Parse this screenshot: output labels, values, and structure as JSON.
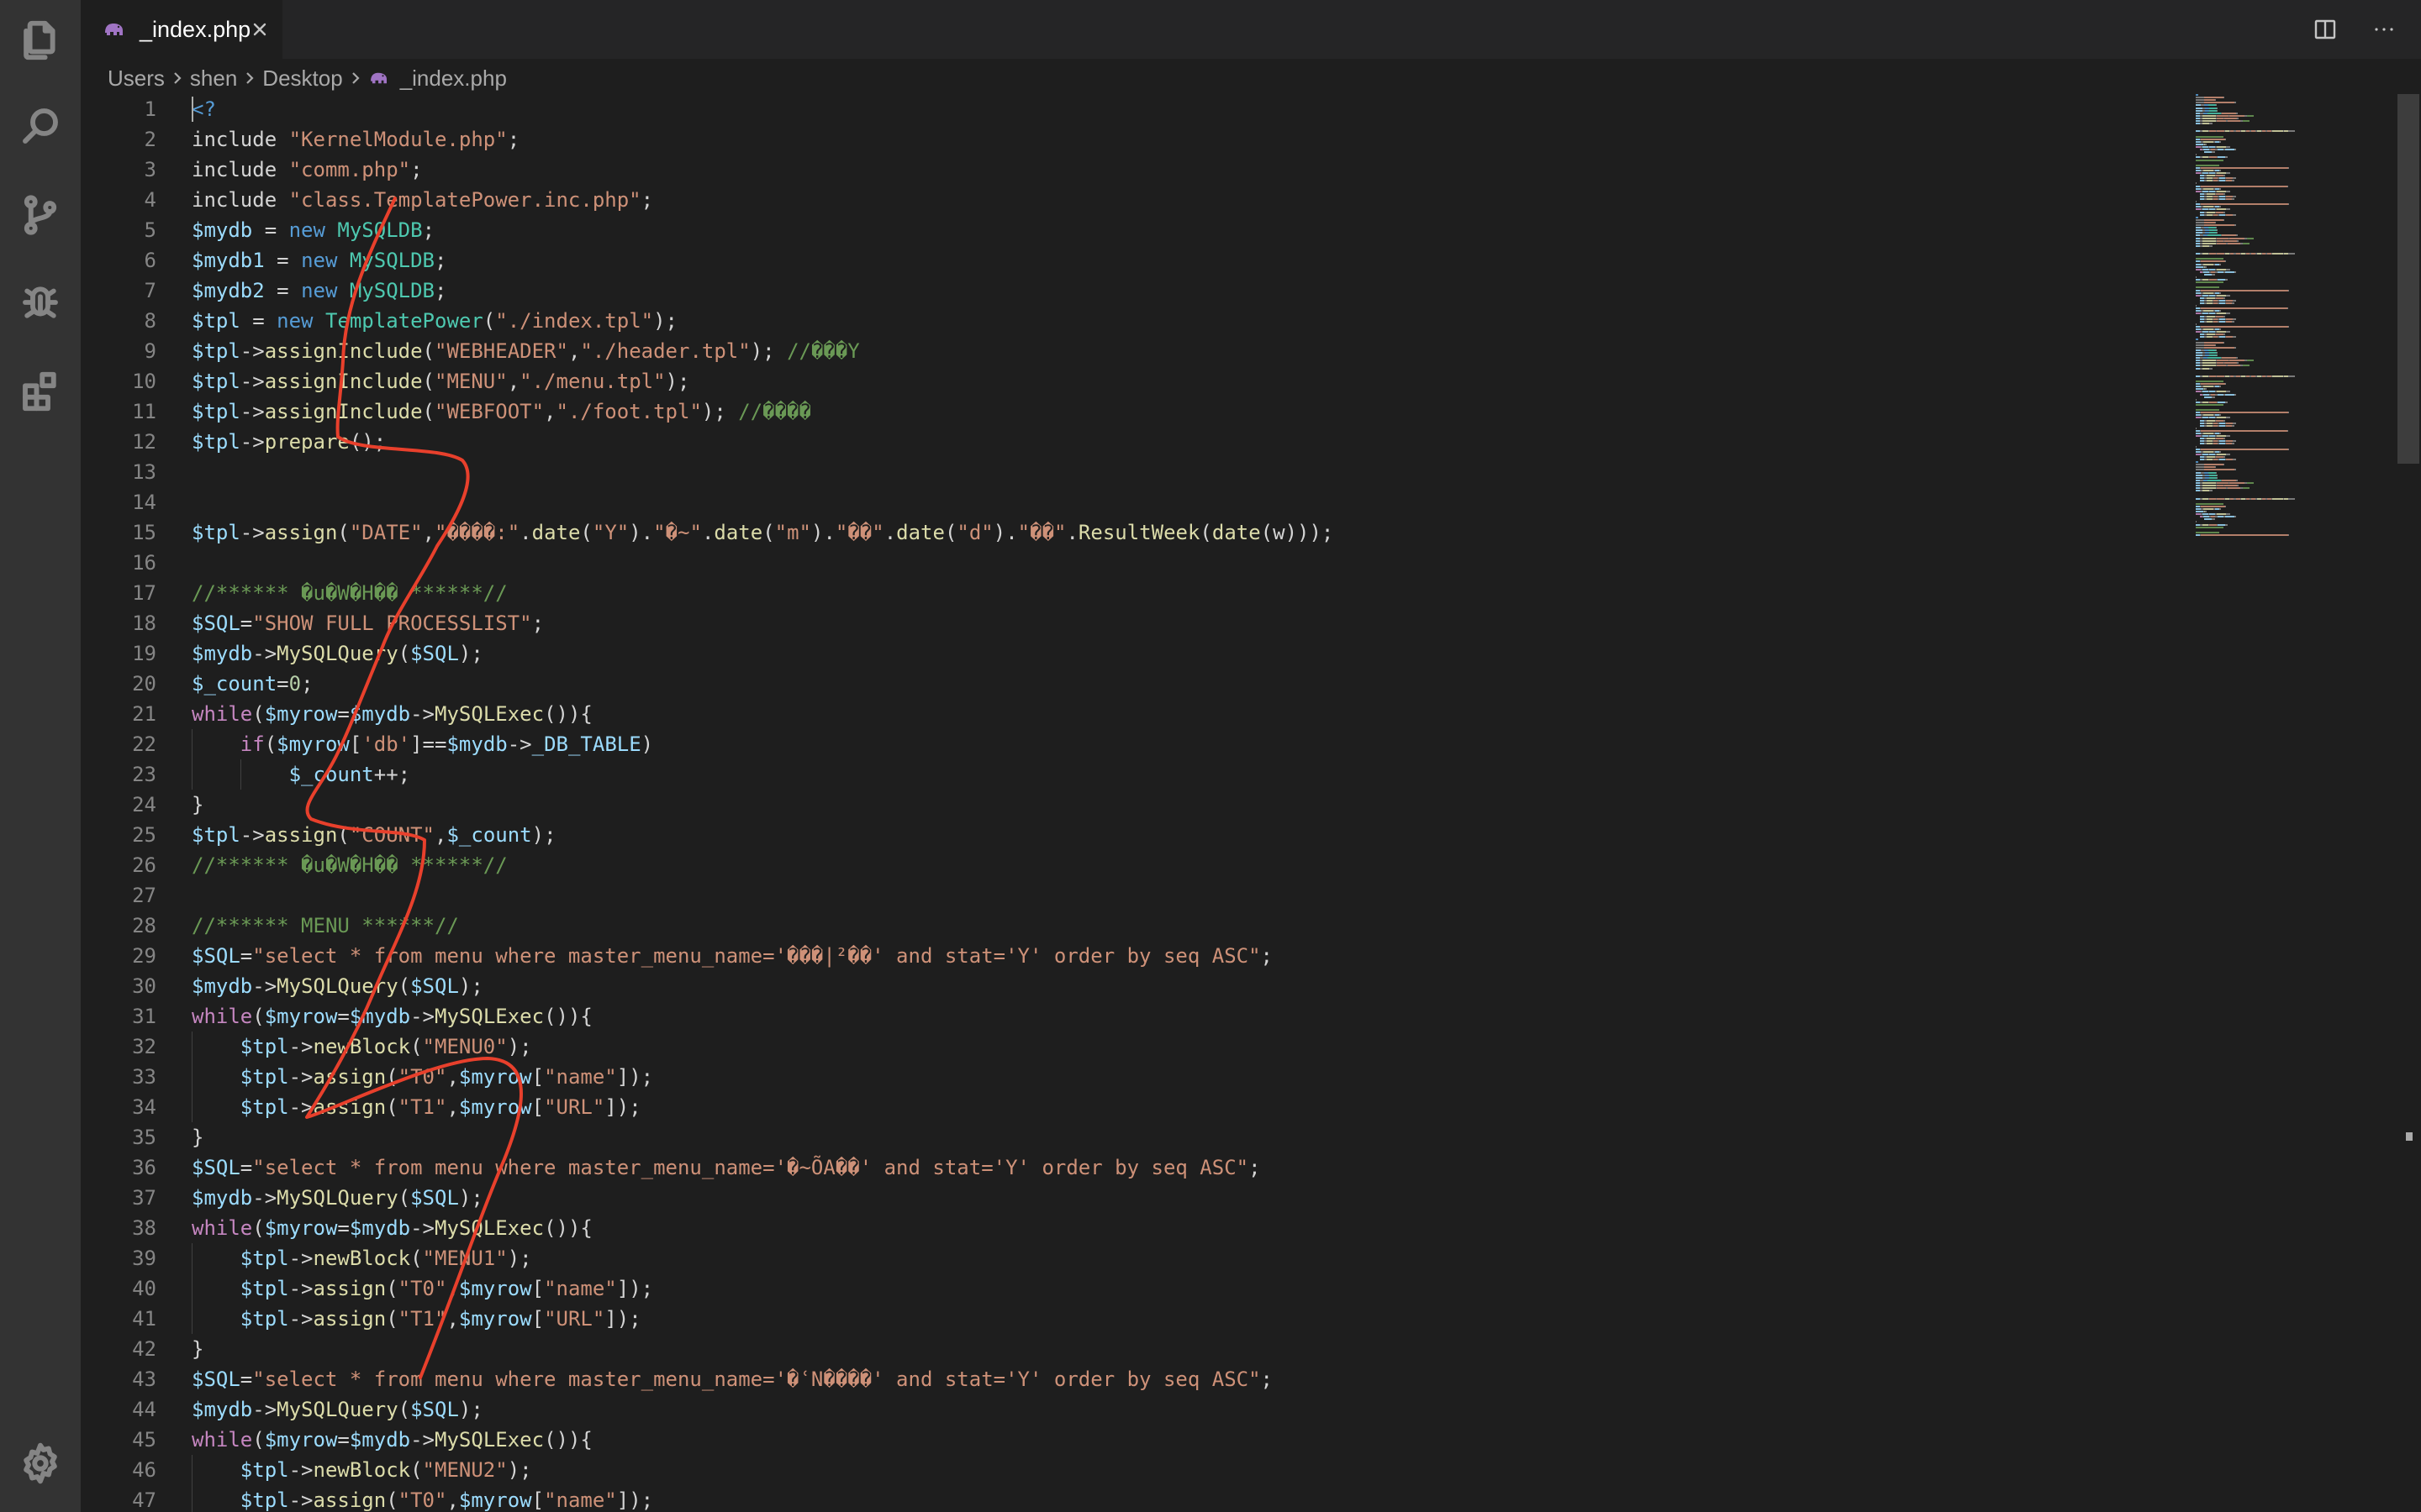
{
  "activity_bar": {
    "items": [
      {
        "name": "explorer-icon",
        "active": false
      },
      {
        "name": "search-icon",
        "active": false
      },
      {
        "name": "source-control-icon",
        "active": false
      },
      {
        "name": "debug-icon",
        "active": false
      },
      {
        "name": "extensions-icon",
        "active": false
      }
    ],
    "bottom": {
      "name": "gear-icon"
    }
  },
  "tab": {
    "label": "_index.php",
    "icon": "php-elephant-icon",
    "accent": "#a074c4"
  },
  "tab_actions": [
    {
      "name": "split-editor-icon"
    },
    {
      "name": "more-actions-icon"
    }
  ],
  "breadcrumb": [
    "Users",
    "shen",
    "Desktop",
    "_index.php"
  ],
  "editor": {
    "first_line_number": 1,
    "lines": [
      [
        [
          "t-tag",
          "<?"
        ]
      ],
      [
        [
          "t-txt",
          "include "
        ],
        [
          "t-str",
          "\"KernelModule.php\""
        ],
        [
          "t-txt",
          ";"
        ]
      ],
      [
        [
          "t-txt",
          "include "
        ],
        [
          "t-str",
          "\"comm.php\""
        ],
        [
          "t-txt",
          ";"
        ]
      ],
      [
        [
          "t-txt",
          "include "
        ],
        [
          "t-str",
          "\"class.TemplatePower.inc.php\""
        ],
        [
          "t-txt",
          ";"
        ]
      ],
      [
        [
          "t-var",
          "$mydb"
        ],
        [
          "t-txt",
          " = "
        ],
        [
          "t-kw2",
          "new "
        ],
        [
          "t-cls",
          "MySQLDB"
        ],
        [
          "t-txt",
          ";"
        ]
      ],
      [
        [
          "t-var",
          "$mydb1"
        ],
        [
          "t-txt",
          " = "
        ],
        [
          "t-kw2",
          "new "
        ],
        [
          "t-cls",
          "MySQLDB"
        ],
        [
          "t-txt",
          ";"
        ]
      ],
      [
        [
          "t-var",
          "$mydb2"
        ],
        [
          "t-txt",
          " = "
        ],
        [
          "t-kw2",
          "new "
        ],
        [
          "t-cls",
          "MySQLDB"
        ],
        [
          "t-txt",
          ";"
        ]
      ],
      [
        [
          "t-var",
          "$tpl"
        ],
        [
          "t-txt",
          " = "
        ],
        [
          "t-kw2",
          "new "
        ],
        [
          "t-cls",
          "TemplatePower"
        ],
        [
          "t-txt",
          "("
        ],
        [
          "t-str",
          "\"./index.tpl\""
        ],
        [
          "t-txt",
          ");"
        ]
      ],
      [
        [
          "t-var",
          "$tpl"
        ],
        [
          "t-txt",
          "->"
        ],
        [
          "t-fn",
          "assignInclude"
        ],
        [
          "t-txt",
          "("
        ],
        [
          "t-str",
          "\"WEBHEADER\""
        ],
        [
          "t-txt",
          ","
        ],
        [
          "t-str",
          "\"./header.tpl\""
        ],
        [
          "t-txt",
          "); "
        ],
        [
          "t-com",
          "//���Y"
        ]
      ],
      [
        [
          "t-var",
          "$tpl"
        ],
        [
          "t-txt",
          "->"
        ],
        [
          "t-fn",
          "assignInclude"
        ],
        [
          "t-txt",
          "("
        ],
        [
          "t-str",
          "\"MENU\""
        ],
        [
          "t-txt",
          ","
        ],
        [
          "t-str",
          "\"./menu.tpl\""
        ],
        [
          "t-txt",
          ");"
        ]
      ],
      [
        [
          "t-var",
          "$tpl"
        ],
        [
          "t-txt",
          "->"
        ],
        [
          "t-fn",
          "assignInclude"
        ],
        [
          "t-txt",
          "("
        ],
        [
          "t-str",
          "\"WEBFOOT\""
        ],
        [
          "t-txt",
          ","
        ],
        [
          "t-str",
          "\"./foot.tpl\""
        ],
        [
          "t-txt",
          "); "
        ],
        [
          "t-com",
          "//����"
        ]
      ],
      [
        [
          "t-var",
          "$tpl"
        ],
        [
          "t-txt",
          "->"
        ],
        [
          "t-fn",
          "prepare"
        ],
        [
          "t-txt",
          "();"
        ]
      ],
      [],
      [],
      [
        [
          "t-var",
          "$tpl"
        ],
        [
          "t-txt",
          "->"
        ],
        [
          "t-fn",
          "assign"
        ],
        [
          "t-txt",
          "("
        ],
        [
          "t-str",
          "\"DATE\""
        ],
        [
          "t-txt",
          ","
        ],
        [
          "t-str",
          "\"����:\""
        ],
        [
          "t-txt",
          "."
        ],
        [
          "t-fn",
          "date"
        ],
        [
          "t-txt",
          "("
        ],
        [
          "t-str",
          "\"Y\""
        ],
        [
          "t-txt",
          ")."
        ],
        [
          "t-str",
          "\"�~\""
        ],
        [
          "t-txt",
          "."
        ],
        [
          "t-fn",
          "date"
        ],
        [
          "t-txt",
          "("
        ],
        [
          "t-str",
          "\"m\""
        ],
        [
          "t-txt",
          ")."
        ],
        [
          "t-str",
          "\"��\""
        ],
        [
          "t-txt",
          "."
        ],
        [
          "t-fn",
          "date"
        ],
        [
          "t-txt",
          "("
        ],
        [
          "t-str",
          "\"d\""
        ],
        [
          "t-txt",
          ")."
        ],
        [
          "t-str",
          "\"��\""
        ],
        [
          "t-txt",
          "."
        ],
        [
          "t-fn",
          "ResultWeek"
        ],
        [
          "t-txt",
          "("
        ],
        [
          "t-fn",
          "date"
        ],
        [
          "t-txt",
          "(w)));"
        ]
      ],
      [],
      [
        [
          "t-com",
          "//****** �u�W�H�� ******//"
        ]
      ],
      [
        [
          "t-var",
          "$SQL"
        ],
        [
          "t-txt",
          "="
        ],
        [
          "t-str",
          "\"SHOW FULL PROCESSLIST\""
        ],
        [
          "t-txt",
          ";"
        ]
      ],
      [
        [
          "t-var",
          "$mydb"
        ],
        [
          "t-txt",
          "->"
        ],
        [
          "t-fn",
          "MySQLQuery"
        ],
        [
          "t-txt",
          "("
        ],
        [
          "t-var",
          "$SQL"
        ],
        [
          "t-txt",
          ");"
        ]
      ],
      [
        [
          "t-var",
          "$_count"
        ],
        [
          "t-txt",
          "="
        ],
        [
          "t-num",
          "0"
        ],
        [
          "t-txt",
          ";"
        ]
      ],
      [
        [
          "t-kw",
          "while"
        ],
        [
          "t-txt",
          "("
        ],
        [
          "t-var",
          "$myrow"
        ],
        [
          "t-txt",
          "="
        ],
        [
          "t-var",
          "$mydb"
        ],
        [
          "t-txt",
          "->"
        ],
        [
          "t-fn",
          "MySQLExec"
        ],
        [
          "t-txt",
          "()){"
        ]
      ],
      [
        [
          "t-txt",
          "    "
        ],
        [
          "t-kw",
          "if"
        ],
        [
          "t-txt",
          "("
        ],
        [
          "t-var",
          "$myrow"
        ],
        [
          "t-txt",
          "["
        ],
        [
          "t-str",
          "'db'"
        ],
        [
          "t-txt",
          "]=="
        ],
        [
          "t-var",
          "$mydb"
        ],
        [
          "t-txt",
          "->"
        ],
        [
          "t-var",
          "_DB_TABLE"
        ],
        [
          "t-txt",
          ")"
        ]
      ],
      [
        [
          "t-txt",
          "        "
        ],
        [
          "t-var",
          "$_count"
        ],
        [
          "t-txt",
          "++;"
        ]
      ],
      [
        [
          "t-txt",
          "}"
        ]
      ],
      [
        [
          "t-var",
          "$tpl"
        ],
        [
          "t-txt",
          "->"
        ],
        [
          "t-fn",
          "assign"
        ],
        [
          "t-txt",
          "("
        ],
        [
          "t-str",
          "\"COUNT\""
        ],
        [
          "t-txt",
          ","
        ],
        [
          "t-var",
          "$_count"
        ],
        [
          "t-txt",
          ");"
        ]
      ],
      [
        [
          "t-com",
          "//****** �u�W�H�� ******//"
        ]
      ],
      [],
      [
        [
          "t-com",
          "//****** MENU ******//"
        ]
      ],
      [
        [
          "t-var",
          "$SQL"
        ],
        [
          "t-txt",
          "="
        ],
        [
          "t-str",
          "\"select * from menu where master_menu_name='���|²��' and stat='Y' order by seq ASC\""
        ],
        [
          "t-txt",
          ";"
        ]
      ],
      [
        [
          "t-var",
          "$mydb"
        ],
        [
          "t-txt",
          "->"
        ],
        [
          "t-fn",
          "MySQLQuery"
        ],
        [
          "t-txt",
          "("
        ],
        [
          "t-var",
          "$SQL"
        ],
        [
          "t-txt",
          ");"
        ]
      ],
      [
        [
          "t-kw",
          "while"
        ],
        [
          "t-txt",
          "("
        ],
        [
          "t-var",
          "$myrow"
        ],
        [
          "t-txt",
          "="
        ],
        [
          "t-var",
          "$mydb"
        ],
        [
          "t-txt",
          "->"
        ],
        [
          "t-fn",
          "MySQLExec"
        ],
        [
          "t-txt",
          "()){"
        ]
      ],
      [
        [
          "t-txt",
          "    "
        ],
        [
          "t-var",
          "$tpl"
        ],
        [
          "t-txt",
          "->"
        ],
        [
          "t-fn",
          "newBlock"
        ],
        [
          "t-txt",
          "("
        ],
        [
          "t-str",
          "\"MENU0\""
        ],
        [
          "t-txt",
          ");"
        ]
      ],
      [
        [
          "t-txt",
          "    "
        ],
        [
          "t-var",
          "$tpl"
        ],
        [
          "t-txt",
          "->"
        ],
        [
          "t-fn",
          "assign"
        ],
        [
          "t-txt",
          "("
        ],
        [
          "t-str",
          "\"T0\""
        ],
        [
          "t-txt",
          ","
        ],
        [
          "t-var",
          "$myrow"
        ],
        [
          "t-txt",
          "["
        ],
        [
          "t-str",
          "\"name\""
        ],
        [
          "t-txt",
          "]);"
        ]
      ],
      [
        [
          "t-txt",
          "    "
        ],
        [
          "t-var",
          "$tpl"
        ],
        [
          "t-txt",
          "->"
        ],
        [
          "t-fn",
          "assign"
        ],
        [
          "t-txt",
          "("
        ],
        [
          "t-str",
          "\"T1\""
        ],
        [
          "t-txt",
          ","
        ],
        [
          "t-var",
          "$myrow"
        ],
        [
          "t-txt",
          "["
        ],
        [
          "t-str",
          "\"URL\""
        ],
        [
          "t-txt",
          "]);"
        ]
      ],
      [
        [
          "t-txt",
          "}"
        ]
      ],
      [
        [
          "t-var",
          "$SQL"
        ],
        [
          "t-txt",
          "="
        ],
        [
          "t-str",
          "\"select * from menu where master_menu_name='�~ÕA��' and stat='Y' order by seq ASC\""
        ],
        [
          "t-txt",
          ";"
        ]
      ],
      [
        [
          "t-var",
          "$mydb"
        ],
        [
          "t-txt",
          "->"
        ],
        [
          "t-fn",
          "MySQLQuery"
        ],
        [
          "t-txt",
          "("
        ],
        [
          "t-var",
          "$SQL"
        ],
        [
          "t-txt",
          ");"
        ]
      ],
      [
        [
          "t-kw",
          "while"
        ],
        [
          "t-txt",
          "("
        ],
        [
          "t-var",
          "$myrow"
        ],
        [
          "t-txt",
          "="
        ],
        [
          "t-var",
          "$mydb"
        ],
        [
          "t-txt",
          "->"
        ],
        [
          "t-fn",
          "MySQLExec"
        ],
        [
          "t-txt",
          "()){"
        ]
      ],
      [
        [
          "t-txt",
          "    "
        ],
        [
          "t-var",
          "$tpl"
        ],
        [
          "t-txt",
          "->"
        ],
        [
          "t-fn",
          "newBlock"
        ],
        [
          "t-txt",
          "("
        ],
        [
          "t-str",
          "\"MENU1\""
        ],
        [
          "t-txt",
          ");"
        ]
      ],
      [
        [
          "t-txt",
          "    "
        ],
        [
          "t-var",
          "$tpl"
        ],
        [
          "t-txt",
          "->"
        ],
        [
          "t-fn",
          "assign"
        ],
        [
          "t-txt",
          "("
        ],
        [
          "t-str",
          "\"T0\""
        ],
        [
          "t-txt",
          ","
        ],
        [
          "t-var",
          "$myrow"
        ],
        [
          "t-txt",
          "["
        ],
        [
          "t-str",
          "\"name\""
        ],
        [
          "t-txt",
          "]);"
        ]
      ],
      [
        [
          "t-txt",
          "    "
        ],
        [
          "t-var",
          "$tpl"
        ],
        [
          "t-txt",
          "->"
        ],
        [
          "t-fn",
          "assign"
        ],
        [
          "t-txt",
          "("
        ],
        [
          "t-str",
          "\"T1\""
        ],
        [
          "t-txt",
          ","
        ],
        [
          "t-var",
          "$myrow"
        ],
        [
          "t-txt",
          "["
        ],
        [
          "t-str",
          "\"URL\""
        ],
        [
          "t-txt",
          "]);"
        ]
      ],
      [
        [
          "t-txt",
          "}"
        ]
      ],
      [
        [
          "t-var",
          "$SQL"
        ],
        [
          "t-txt",
          "="
        ],
        [
          "t-str",
          "\"select * from menu where master_menu_name='�ʿN����' and stat='Y' order by seq ASC\""
        ],
        [
          "t-txt",
          ";"
        ]
      ],
      [
        [
          "t-var",
          "$mydb"
        ],
        [
          "t-txt",
          "->"
        ],
        [
          "t-fn",
          "MySQLQuery"
        ],
        [
          "t-txt",
          "("
        ],
        [
          "t-var",
          "$SQL"
        ],
        [
          "t-txt",
          ");"
        ]
      ],
      [
        [
          "t-kw",
          "while"
        ],
        [
          "t-txt",
          "("
        ],
        [
          "t-var",
          "$myrow"
        ],
        [
          "t-txt",
          "="
        ],
        [
          "t-var",
          "$mydb"
        ],
        [
          "t-txt",
          "->"
        ],
        [
          "t-fn",
          "MySQLExec"
        ],
        [
          "t-txt",
          "()){"
        ]
      ],
      [
        [
          "t-txt",
          "    "
        ],
        [
          "t-var",
          "$tpl"
        ],
        [
          "t-txt",
          "->"
        ],
        [
          "t-fn",
          "newBlock"
        ],
        [
          "t-txt",
          "("
        ],
        [
          "t-str",
          "\"MENU2\""
        ],
        [
          "t-txt",
          ");"
        ]
      ],
      [
        [
          "t-txt",
          "    "
        ],
        [
          "t-var",
          "$tpl"
        ],
        [
          "t-txt",
          "->"
        ],
        [
          "t-fn",
          "assign"
        ],
        [
          "t-txt",
          "("
        ],
        [
          "t-str",
          "\"T0\""
        ],
        [
          "t-txt",
          ","
        ],
        [
          "t-var",
          "$myrow"
        ],
        [
          "t-txt",
          "["
        ],
        [
          "t-str",
          "\"name\""
        ],
        [
          "t-txt",
          "]);"
        ]
      ]
    ]
  },
  "annotation": {
    "name": "red-hand-drawn-stroke",
    "color": "#e8402c"
  }
}
